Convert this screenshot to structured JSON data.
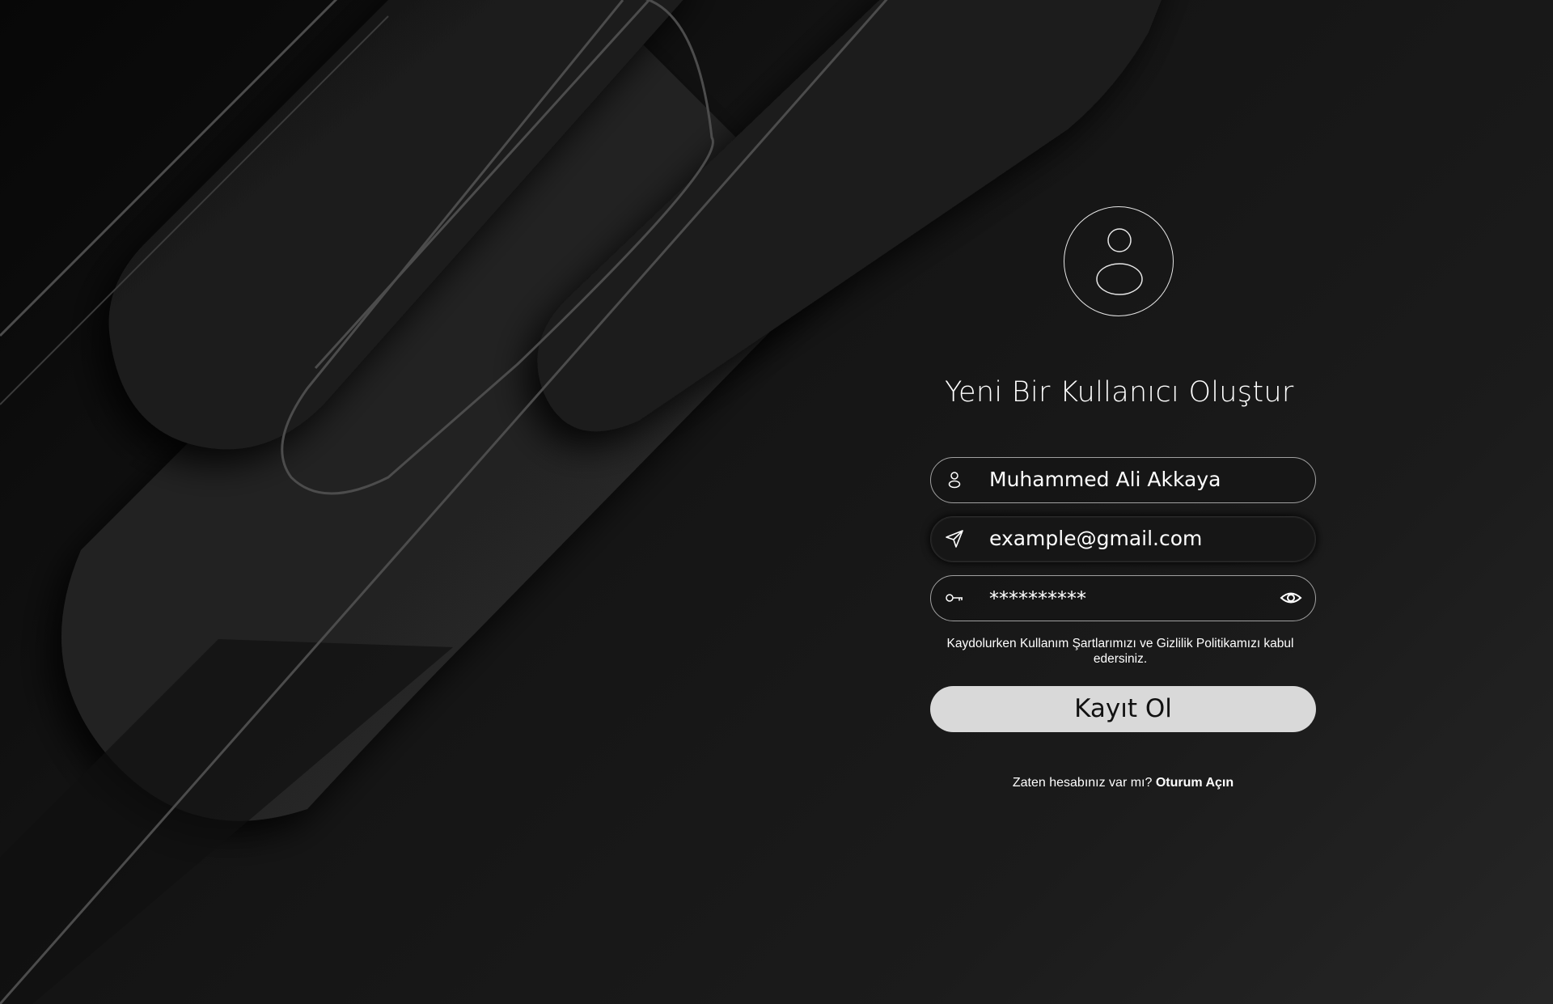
{
  "register": {
    "title": "Yeni Bir Kullanıcı Oluştur",
    "name_field": {
      "value": "Muhammed Ali Akkaya",
      "icon": "user-icon"
    },
    "email_field": {
      "value": "example@gmail.com",
      "icon": "paper-plane-icon"
    },
    "password_field": {
      "value": "**********",
      "icon": "key-icon",
      "toggle_icon": "eye-icon"
    },
    "terms_text": "Kaydolurken Kullanım Şartlarımızı ve Gizlilik Politikamızı kabul edersiniz.",
    "submit_label": "Kayıt Ol",
    "login_prompt": "Zaten hesabınız var mı?",
    "login_link": "Oturum Açın"
  },
  "colors": {
    "background": "#141414",
    "field_border": "#a0a0a0",
    "button_bg": "#d9d9d9",
    "button_text": "#111111",
    "text": "#ffffff"
  }
}
